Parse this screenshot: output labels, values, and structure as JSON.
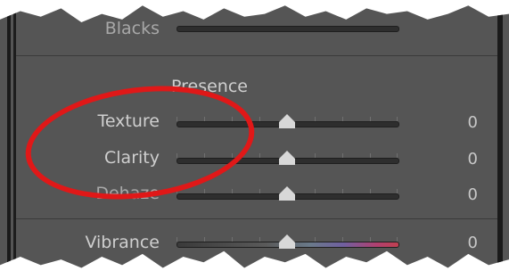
{
  "panel": {
    "section_title": "Presence",
    "blacks_label": "Blacks",
    "sliders": [
      {
        "label": "Texture",
        "value": "0",
        "level": 0.5
      },
      {
        "label": "Clarity",
        "value": "0",
        "level": 0.5
      },
      {
        "label": "Dehaze",
        "value": "0",
        "level": 0.5
      },
      {
        "label": "Vibrance",
        "value": "0",
        "level": 0.5
      }
    ]
  },
  "colors": {
    "panel_bg": "#555555",
    "annotation": "#e01818"
  }
}
